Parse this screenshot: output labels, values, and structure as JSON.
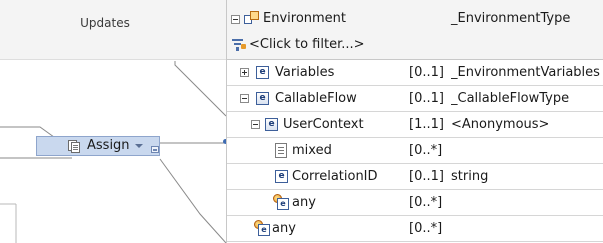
{
  "left_panel": {
    "header_title": "Updates"
  },
  "header": {
    "root_name": "Environment",
    "root_type": "_EnvironmentType",
    "filter_text": "<Click to filter...>"
  },
  "assign_node": {
    "label": "Assign"
  },
  "tree": {
    "rows": [
      {
        "name": "Variables",
        "cardinality": "[0..1]",
        "type": "_EnvironmentVariables",
        "expanded": false
      },
      {
        "name": "CallableFlow",
        "cardinality": "[0..1]",
        "type": "_CallableFlowType",
        "expanded": true
      },
      {
        "name": "UserContext",
        "cardinality": "[1..1]",
        "type": "<Anonymous>",
        "expanded": true
      },
      {
        "name": "mixed",
        "cardinality": "[0..*]",
        "type": ""
      },
      {
        "name": "CorrelationID",
        "cardinality": "[0..1]",
        "type": "string"
      },
      {
        "name": "any",
        "cardinality": "[0..*]",
        "type": ""
      },
      {
        "name": "any",
        "cardinality": "[0..*]",
        "type": ""
      }
    ]
  },
  "icons": {
    "element": "element-e-icon",
    "mixed": "mixed-content-icon",
    "any": "any-wildcard-icon",
    "environment": "environment-icon",
    "filter": "filter-icon"
  },
  "colors": {
    "header_bg": "#f4f4f4",
    "assign_bg": "#c9d8ee",
    "connector": "#3d6bb3",
    "grid_line": "#d6d6d6"
  }
}
